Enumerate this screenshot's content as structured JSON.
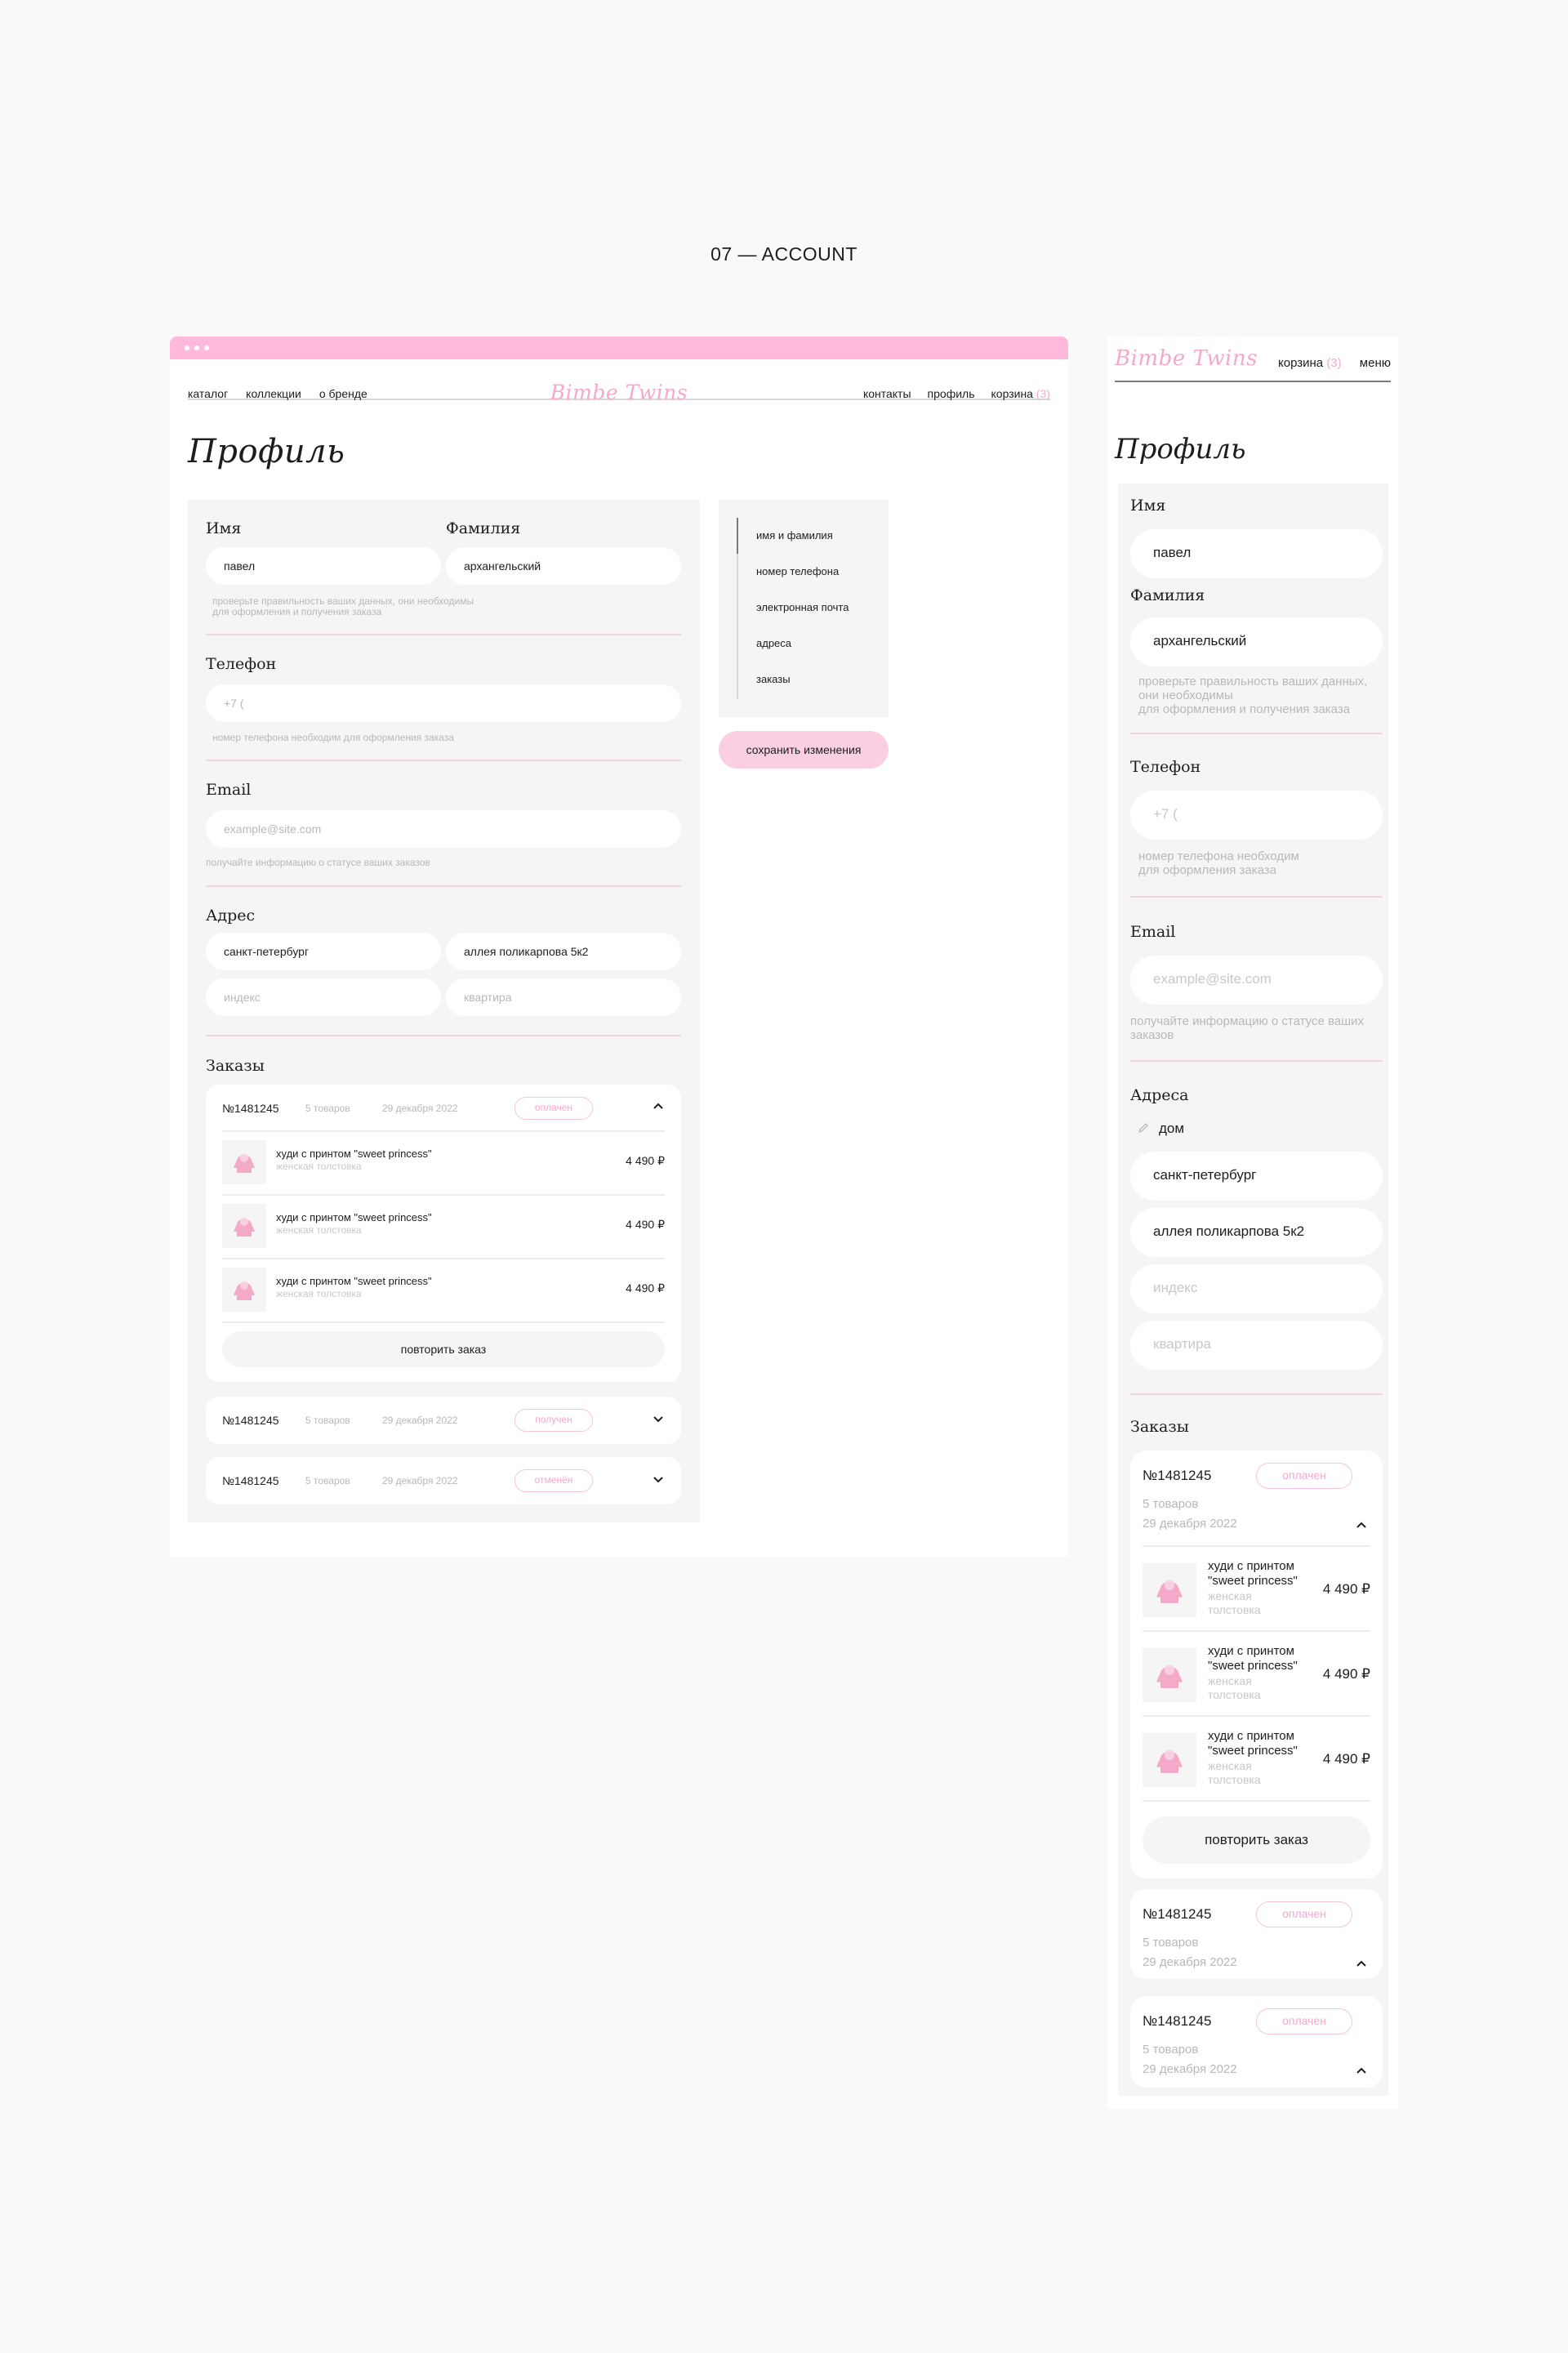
{
  "section_title": "07 — ACCOUNT",
  "brand": {
    "logo_text": "Bimbe Twins",
    "accent": "#f6a8cb",
    "bar_color": "#ffb9da"
  },
  "desktop": {
    "nav_left": [
      "каталог",
      "коллекции",
      "о бренде"
    ],
    "nav_right": [
      "контакты",
      "профиль",
      "корзина"
    ],
    "cart_count": "(3)",
    "title": "Профиль",
    "first_name_label": "Имя",
    "last_name_label": "Фамилия",
    "first_name_value": "павел",
    "last_name_value": "архангельский",
    "name_hint": "проверьте правильность ваших данных, они необходимы\nдля оформления и получения заказа",
    "phone_label": "Телефон",
    "phone_placeholder": "+7 (",
    "phone_hint": "номер телефона необходим для оформления заказа",
    "email_label": "Email",
    "email_placeholder": "example@site.com",
    "email_hint": "получайте информацию о статусе ваших заказов",
    "address_label": "Адрес",
    "city_value": "санкт-петербург",
    "street_value": "аллея поликарпова 5к2",
    "index_placeholder": "индекс",
    "apartment_placeholder": "квартира",
    "orders_label": "Заказы",
    "orders": [
      {
        "number": "№1481245",
        "items": "5 товаров",
        "date": "29 декабря 2022",
        "status": "оплачен",
        "expanded": true
      },
      {
        "number": "№1481245",
        "items": "5 товаров",
        "date": "29 декабря 2022",
        "status": "получен",
        "expanded": false
      },
      {
        "number": "№1481245",
        "items": "5 товаров",
        "date": "29 декабря 2022",
        "status": "отменён",
        "expanded": false
      }
    ],
    "products": [
      {
        "name": "худи с принтом \"sweet princess\"",
        "sub": "женская толстовка",
        "price": "4 490 ₽"
      },
      {
        "name": "худи с принтом \"sweet princess\"",
        "sub": "женская толстовка",
        "price": "4 490 ₽"
      },
      {
        "name": "худи с принтом \"sweet princess\"",
        "sub": "женская толстовка",
        "price": "4 490 ₽"
      }
    ],
    "repeat_label": "повторить заказ",
    "side_nav": [
      "имя и фамилия",
      "номер телефона",
      "электронная почта",
      "адреса",
      "заказы"
    ],
    "save_label": "сохранить изменения"
  },
  "mobile": {
    "cart": "корзина",
    "cart_count": "(3)",
    "menu": "меню",
    "title": "Профиль",
    "first_name_label": "Имя",
    "first_name_value": "павел",
    "last_name_label": "Фамилия",
    "last_name_value": "архангельский",
    "name_hint": "проверьте правильность ваших данных,\nони необходимы\nдля оформления и получения заказа",
    "phone_label": "Телефон",
    "phone_placeholder": "+7 (",
    "phone_hint": "номер телефона необходим\nдля оформления заказа",
    "email_label": "Email",
    "email_placeholder": "example@site.com",
    "email_hint": "получайте информацию о статусе ваших\nзаказов",
    "address_label": "Адреса",
    "address_name": "дом",
    "city_value": "санкт-петербург",
    "street_value": "аллея поликарпова 5к2",
    "index_placeholder": "индекс",
    "apartment_placeholder": "квартира",
    "orders_label": "Заказы",
    "orders": [
      {
        "number": "№1481245",
        "status": "оплачен",
        "items": "5 товаров",
        "date": "29 декабря 2022"
      },
      {
        "number": "№1481245",
        "status": "оплачен",
        "items": "5 товаров",
        "date": "29 декабря 2022"
      },
      {
        "number": "№1481245",
        "status": "оплачен",
        "items": "5 товаров",
        "date": "29 декабря 2022"
      }
    ],
    "products": [
      {
        "name": "худи с принтом \"sweet princess\"",
        "sub": "женская толстовка",
        "price": "4 490 ₽"
      },
      {
        "name": "худи с принтом \"sweet princess\"",
        "sub": "женская толстовка",
        "price": "4 490 ₽"
      },
      {
        "name": "худи с принтом \"sweet princess\"",
        "sub": "женская толстовка",
        "price": "4 490 ₽"
      }
    ],
    "repeat_label": "повторить заказ"
  }
}
